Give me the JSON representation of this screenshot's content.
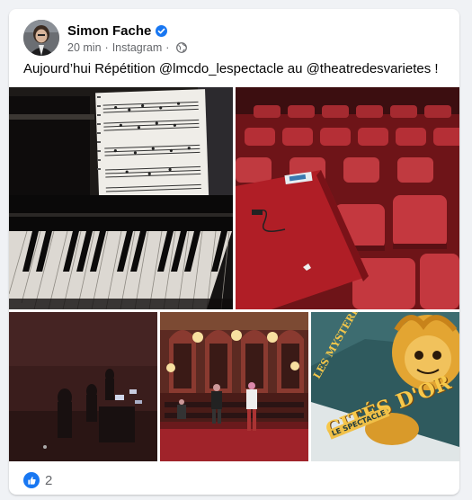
{
  "post": {
    "author": "Simon Fache",
    "time": "20 min",
    "separator": "·",
    "source": "Instagram",
    "text": "Aujourd’hui Répétition @lmcdo_lespectacle au @theatredesvarietes !",
    "reactions_count": "2"
  },
  "photos": {
    "poster_line1": "LES MYSTERIEUSES",
    "poster_line2": "CITÉS D'OR",
    "poster_line3": "LE SPECTACLE"
  },
  "colors": {
    "accent": "#1877f2",
    "text": "#050505",
    "secondary_text": "#65676b"
  },
  "icons": {
    "verified": "verified-check-badge",
    "audience": "globe-icon",
    "reaction": "thumbs-up-icon"
  }
}
